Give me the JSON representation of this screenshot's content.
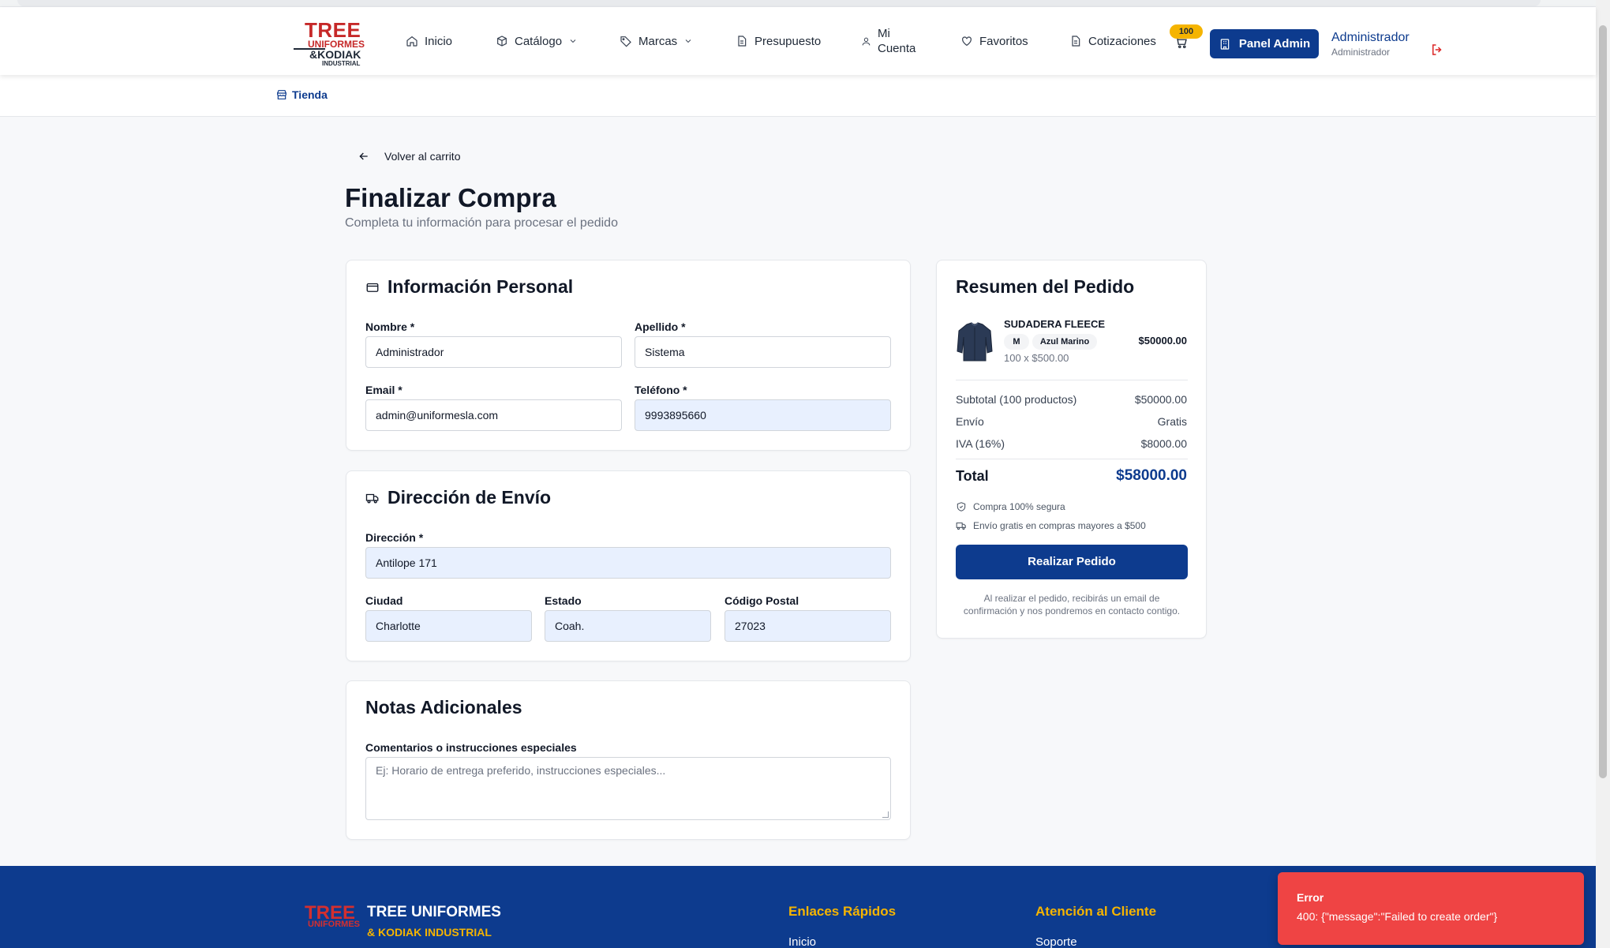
{
  "header": {
    "logo": {
      "line1": "TREE",
      "line2": "UNIFORMES",
      "line3": "&KODIAK",
      "line4": "INDUSTRIAL"
    },
    "nav": {
      "inicio": "Inicio",
      "catalogo": "Catálogo",
      "marcas": "Marcas",
      "presupuesto": "Presupuesto",
      "mi": "Mi",
      "cuenta": "Cuenta",
      "favoritos": "Favoritos",
      "cotizaciones": "Cotizaciones"
    },
    "cart_count": "100",
    "admin_button": "Panel Admin",
    "user_name": "Administrador",
    "user_role": "Administrador"
  },
  "breadcrumb": {
    "label": "Tienda"
  },
  "back_link": "Volver al carrito",
  "page": {
    "title": "Finalizar Compra",
    "subtitle": "Completa tu información para procesar el pedido"
  },
  "personal": {
    "title": "Información Personal",
    "nombre_label": "Nombre *",
    "nombre_value": "Administrador",
    "apellido_label": "Apellido *",
    "apellido_value": "Sistema",
    "email_label": "Email *",
    "email_value": "admin@uniformesla.com",
    "telefono_label": "Teléfono *",
    "telefono_value": "9993895660"
  },
  "shipping": {
    "title": "Dirección de Envío",
    "direccion_label": "Dirección *",
    "direccion_value": "Antilope 171",
    "ciudad_label": "Ciudad",
    "ciudad_value": "Charlotte",
    "estado_label": "Estado",
    "estado_value": "Coah.",
    "cp_label": "Código Postal",
    "cp_value": "27023"
  },
  "notes": {
    "title": "Notas Adicionales",
    "label": "Comentarios o instrucciones especiales",
    "placeholder": "Ej: Horario de entrega preferido, instrucciones especiales..."
  },
  "summary": {
    "title": "Resumen del Pedido",
    "product": {
      "name": "SUDADERA FLEECE",
      "size": "M",
      "color": "Azul Marino",
      "qty_line": "100 x $500.00",
      "price": "$50000.00"
    },
    "subtotal_label": "Subtotal (100 productos)",
    "subtotal_value": "$50000.00",
    "envio_label": "Envío",
    "envio_value": "Gratis",
    "iva_label": "IVA (16%)",
    "iva_value": "$8000.00",
    "total_label": "Total",
    "total_value": "$58000.00",
    "perk_secure": "Compra 100% segura",
    "perk_shipping": "Envío gratis en compras mayores a $500",
    "order_button": "Realizar Pedido",
    "note": "Al realizar el pedido, recibirás un email de confirmación y nos pondremos en contacto contigo."
  },
  "footer": {
    "logo_top": "TREE",
    "logo_bottom": "UNIFORMES",
    "brand": "TREE UNIFORMES",
    "brand_sub": "& KODIAK INDUSTRIAL",
    "col1_title": "Enlaces Rápidos",
    "col1_item": "Inicio",
    "col2_title": "Atención al Cliente",
    "col2_item": "Soporte"
  },
  "toast": {
    "title": "Error",
    "message": "400: {\"message\":\"Failed to create order\"}"
  },
  "colors": {
    "primary": "#0d3b8e",
    "accent": "#f5b400",
    "error": "#ef4444",
    "brand_red": "#c62828",
    "autofill": "#e8f0fe"
  }
}
